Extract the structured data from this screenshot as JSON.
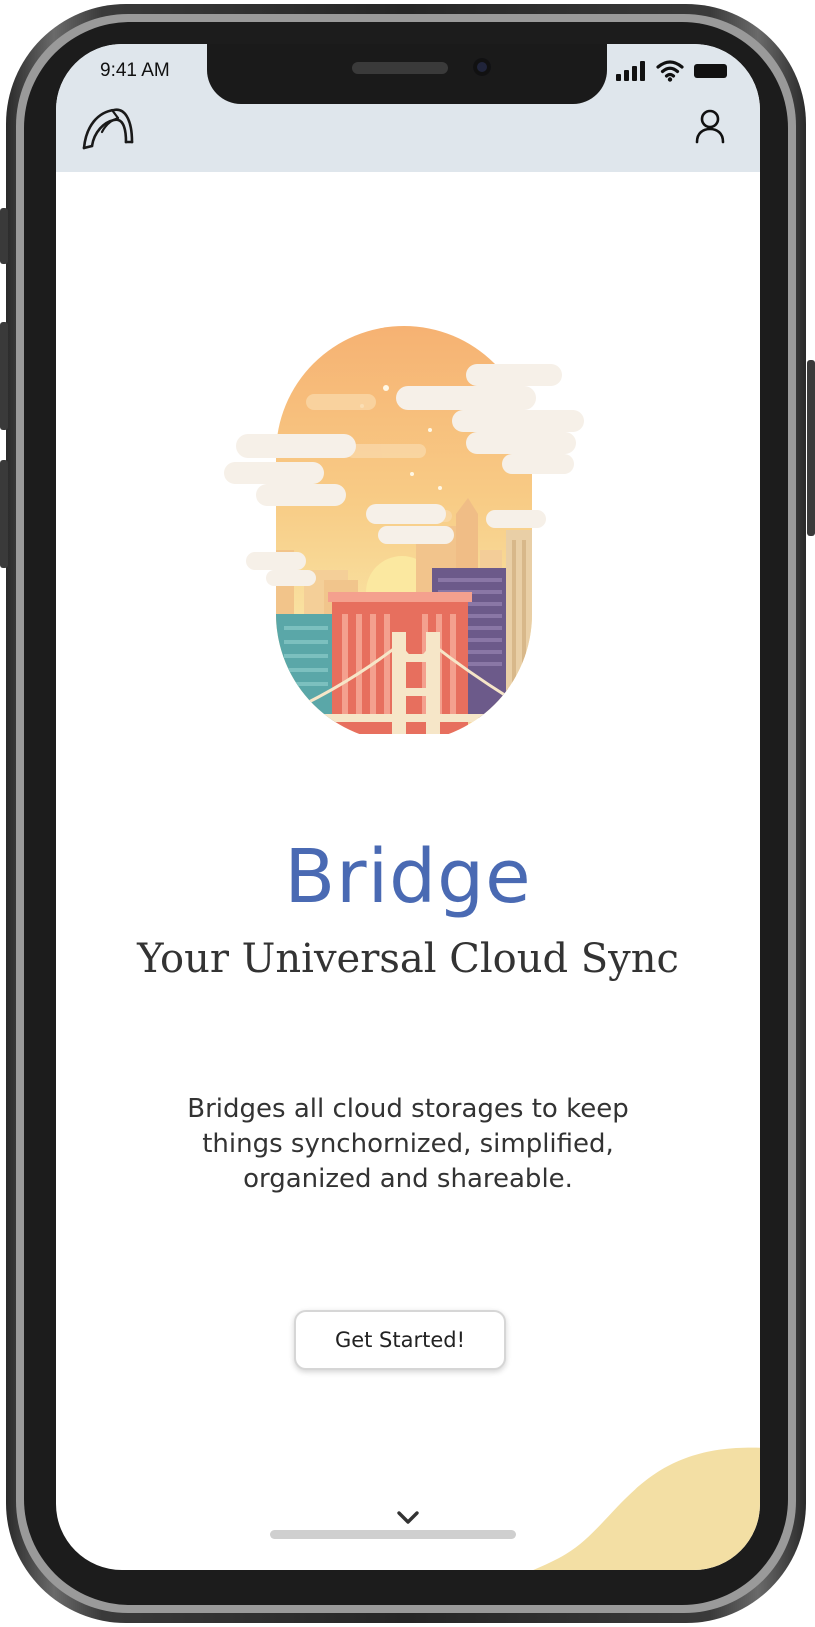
{
  "status_bar": {
    "time": "9:41 AM",
    "icons": [
      "signal-icon",
      "wifi-icon",
      "battery-icon"
    ]
  },
  "header": {
    "logo_icon": "arch-logo-icon",
    "profile_icon": "user-profile-icon"
  },
  "hero": {
    "illustration": "city-skyline-bridge-illustration"
  },
  "main": {
    "title": "Bridge",
    "subtitle": "Your Universal Cloud Sync",
    "description": "Bridges all cloud storages to keep things synchornized, simplified, organized and shareable.",
    "cta_label": "Get Started!"
  },
  "footer": {
    "scroll_icon": "chevron-down-icon"
  },
  "colors": {
    "header_bg": "#dfe6ec",
    "title": "#4a6ab3",
    "accent_blob": "#f3dfa4"
  }
}
